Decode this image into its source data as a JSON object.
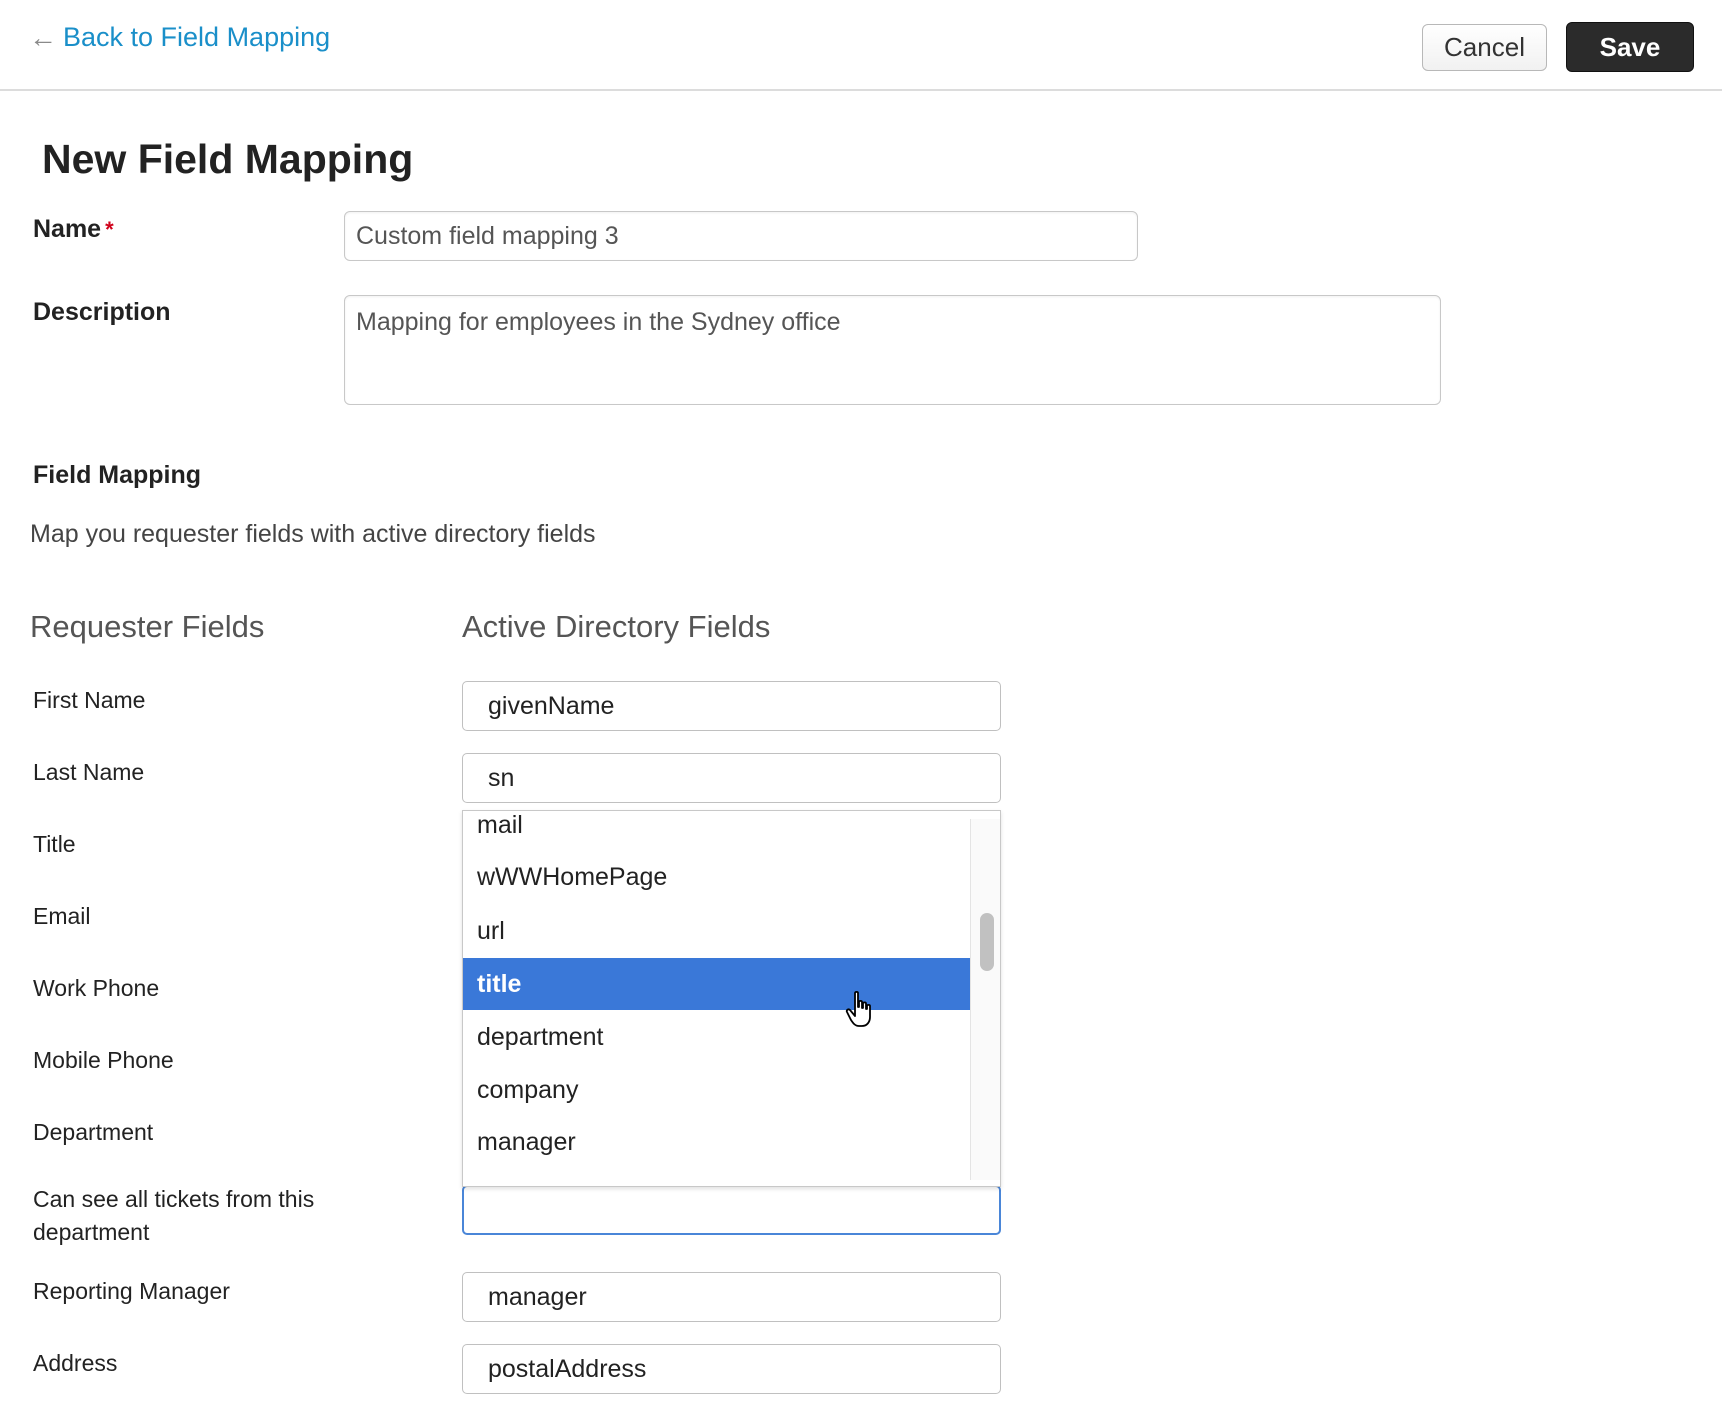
{
  "header": {
    "back_label": "Back to Field Mapping",
    "cancel_label": "Cancel",
    "save_label": "Save"
  },
  "form": {
    "title": "New Field Mapping",
    "name_label": "Name",
    "required_mark": "*",
    "name_value": "Custom field mapping 3",
    "description_label": "Description",
    "description_value": "Mapping for employees in the Sydney office"
  },
  "mapping": {
    "section_title": "Field Mapping",
    "section_desc": "Map you requester fields with active directory fields",
    "col_requester": "Requester Fields",
    "col_ad": "Active Directory Fields",
    "rows": [
      {
        "label": "First Name",
        "value": "givenName"
      },
      {
        "label": "Last Name",
        "value": "sn"
      },
      {
        "label": "Title",
        "value": ""
      },
      {
        "label": "Email",
        "value": ""
      },
      {
        "label": "Work Phone",
        "value": ""
      },
      {
        "label": "Mobile Phone",
        "value": ""
      },
      {
        "label": "Department",
        "value": ""
      },
      {
        "label": "Can see all tickets from this department",
        "value": ""
      },
      {
        "label": "Reporting Manager",
        "value": "manager"
      },
      {
        "label": "Address",
        "value": "postalAddress"
      }
    ]
  },
  "dropdown": {
    "options": [
      "mail",
      "wWWHomePage",
      "url",
      "title",
      "department",
      "company",
      "manager"
    ],
    "selected": "title"
  },
  "colors": {
    "link": "#1a8fc9",
    "selected_option": "#3a78d8",
    "focus_border": "#4a86d8",
    "required": "#d0021b",
    "save_button": "#2b2b2b"
  }
}
